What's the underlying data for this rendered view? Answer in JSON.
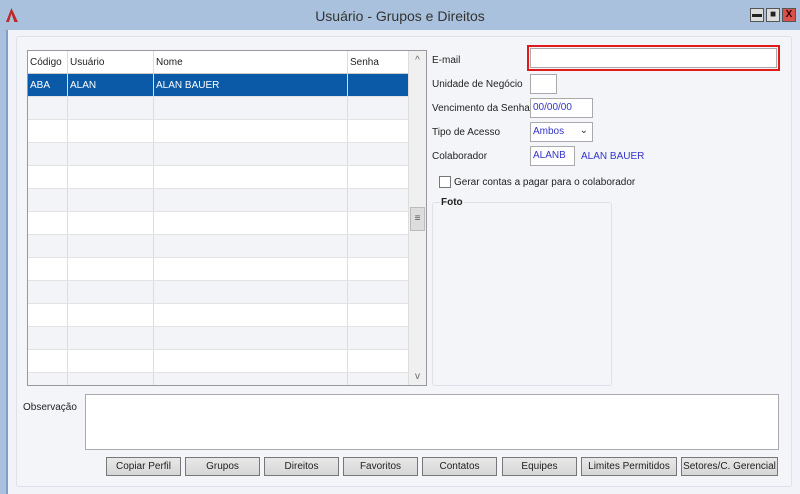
{
  "window": {
    "title": "Usuário - Grupos e Direitos",
    "minimize": "▬",
    "maximize": "■",
    "close": "X"
  },
  "grid": {
    "columns": [
      "Código",
      "Usuário",
      "Nome",
      "Senha"
    ],
    "rows": [
      {
        "codigo": "ABA",
        "usuario": "ALAN",
        "nome": "ALAN BAUER",
        "senha": ""
      }
    ],
    "scroll_up": "^",
    "scroll_thumb": "≡",
    "scroll_down": "v"
  },
  "form": {
    "email_label": "E-mail",
    "email_value": "",
    "unidade_label": "Unidade de Negócio",
    "unidade_value": "",
    "vencimento_label": "Vencimento da Senha",
    "vencimento_value": "00/00/00",
    "tipo_label": "Tipo de Acesso",
    "tipo_value": "Ambos",
    "colaborador_label": "Colaborador",
    "colaborador_code": "ALANB",
    "colaborador_name": "ALAN BAUER",
    "gerar_label": "Gerar contas a pagar para o colaborador",
    "gerar_checked": false,
    "foto_label": "Foto",
    "observacao_label": "Observação",
    "observacao_value": ""
  },
  "buttons": [
    "Copiar Perfil",
    "Grupos",
    "Direitos",
    "Favoritos",
    "Contatos",
    "Equipes",
    "Limites Permitidos",
    "Setores/C. Gerencial"
  ],
  "colors": {
    "highlight": "#e0191b",
    "selection": "#0b5aa8",
    "titlebar": "#a9c1dc"
  }
}
